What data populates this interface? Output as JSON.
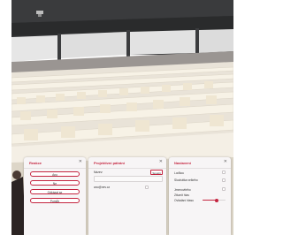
{
  "colors": {
    "accent": "#c4243f",
    "panel_bg": "#f7f5f6"
  },
  "panels": {
    "reactions": {
      "title": "Reakce",
      "buttons": [
        "Ano",
        "Ne",
        "Odkázat se",
        "Pomůh"
      ]
    },
    "lecture": {
      "title": "Projektivní pátrání",
      "name_label": "Název:",
      "action_button": "Spustit",
      "input_placeholder": "",
      "user": "ano@nev.cz"
    },
    "settings": {
      "title": "Nastavení",
      "options": [
        "Loďkou",
        "Sluchátka velkého",
        "Jmenovitého",
        "Ztlumit hlas"
      ],
      "slider_label": "Ovládání hlasu",
      "volume_fraction": 0.6
    }
  }
}
